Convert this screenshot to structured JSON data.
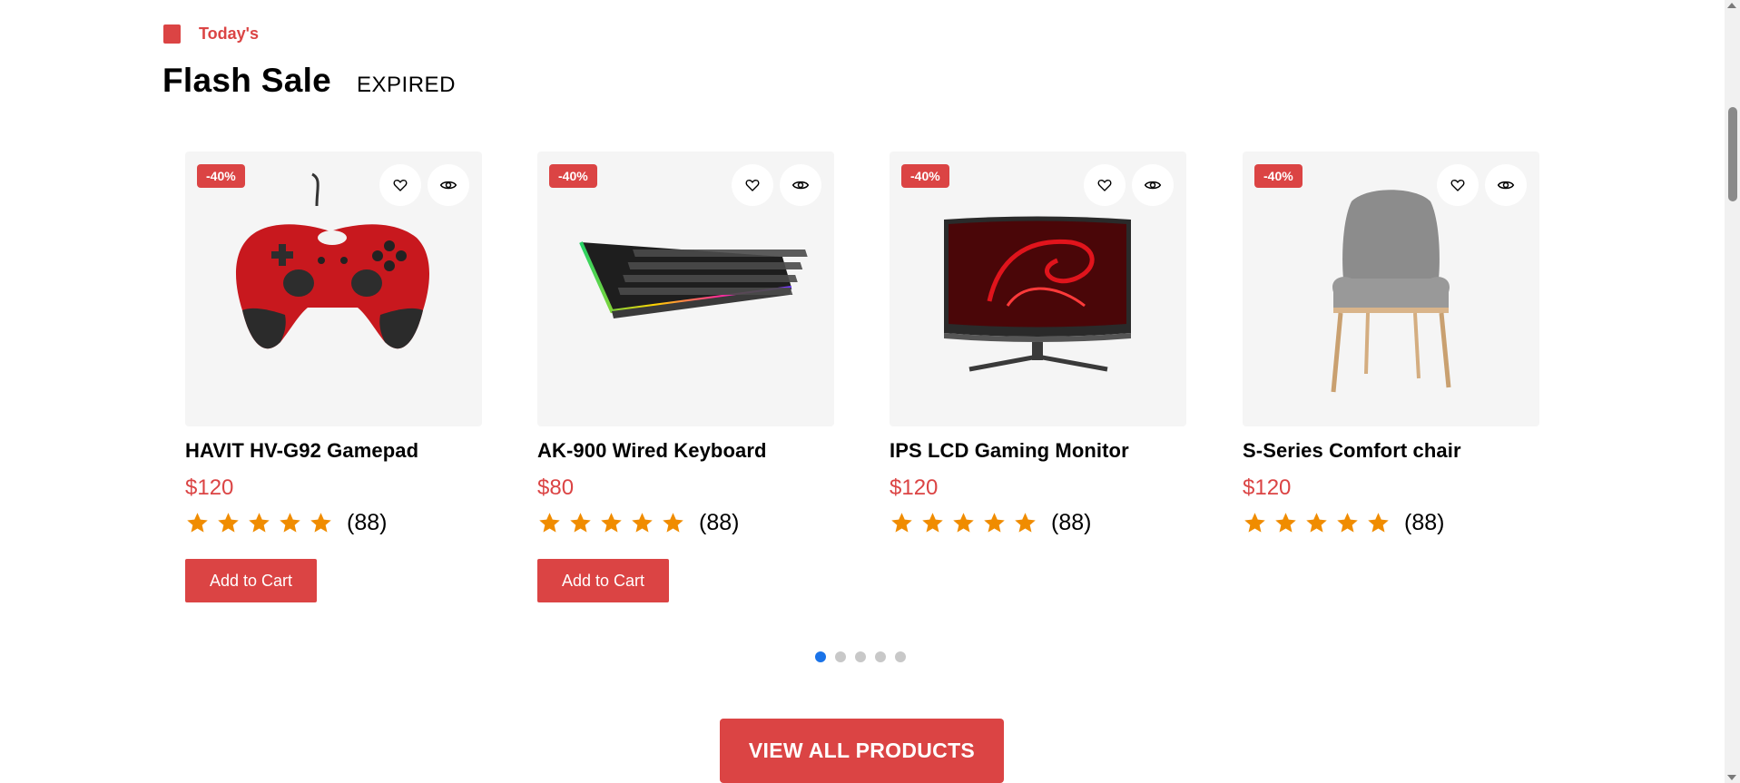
{
  "section": {
    "tag": "Today's",
    "title": "Flash Sale",
    "status": "EXPIRED"
  },
  "colors": {
    "accent": "#db4444",
    "star": "#f08c00",
    "active_dot": "#1a73e8"
  },
  "icons": {
    "wishlist": "heart-icon",
    "view": "eye-icon",
    "rating": "star-icon"
  },
  "products": [
    {
      "name": "HAVIT HV-G92 Gamepad",
      "price": "$120",
      "discount": "-40%",
      "rating_count": "(88)",
      "stars": 5,
      "cart_label": "Add to Cart"
    },
    {
      "name": "AK-900 Wired Keyboard",
      "price": "$80",
      "discount": "-40%",
      "rating_count": "(88)",
      "stars": 5,
      "cart_label": "Add to Cart"
    },
    {
      "name": "IPS LCD Gaming Monitor",
      "price": "$120",
      "discount": "-40%",
      "rating_count": "(88)",
      "stars": 5
    },
    {
      "name": "S-Series Comfort chair",
      "price": "$120",
      "discount": "-40%",
      "rating_count": "(88)",
      "stars": 5
    }
  ],
  "carousel": {
    "pages": 5,
    "active": 1
  },
  "view_all_label": "VIEW ALL PRODUCTS"
}
